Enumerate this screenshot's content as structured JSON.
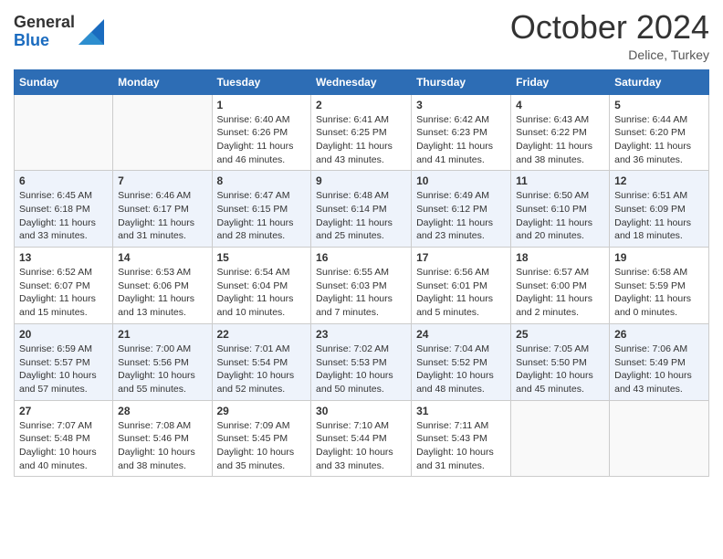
{
  "header": {
    "logo_general": "General",
    "logo_blue": "Blue",
    "month_title": "October 2024",
    "subtitle": "Delice, Turkey"
  },
  "days_of_week": [
    "Sunday",
    "Monday",
    "Tuesday",
    "Wednesday",
    "Thursday",
    "Friday",
    "Saturday"
  ],
  "weeks": [
    [
      {
        "day": "",
        "sunrise": "",
        "sunset": "",
        "daylight": ""
      },
      {
        "day": "",
        "sunrise": "",
        "sunset": "",
        "daylight": ""
      },
      {
        "day": "1",
        "sunrise": "Sunrise: 6:40 AM",
        "sunset": "Sunset: 6:26 PM",
        "daylight": "Daylight: 11 hours and 46 minutes."
      },
      {
        "day": "2",
        "sunrise": "Sunrise: 6:41 AM",
        "sunset": "Sunset: 6:25 PM",
        "daylight": "Daylight: 11 hours and 43 minutes."
      },
      {
        "day": "3",
        "sunrise": "Sunrise: 6:42 AM",
        "sunset": "Sunset: 6:23 PM",
        "daylight": "Daylight: 11 hours and 41 minutes."
      },
      {
        "day": "4",
        "sunrise": "Sunrise: 6:43 AM",
        "sunset": "Sunset: 6:22 PM",
        "daylight": "Daylight: 11 hours and 38 minutes."
      },
      {
        "day": "5",
        "sunrise": "Sunrise: 6:44 AM",
        "sunset": "Sunset: 6:20 PM",
        "daylight": "Daylight: 11 hours and 36 minutes."
      }
    ],
    [
      {
        "day": "6",
        "sunrise": "Sunrise: 6:45 AM",
        "sunset": "Sunset: 6:18 PM",
        "daylight": "Daylight: 11 hours and 33 minutes."
      },
      {
        "day": "7",
        "sunrise": "Sunrise: 6:46 AM",
        "sunset": "Sunset: 6:17 PM",
        "daylight": "Daylight: 11 hours and 31 minutes."
      },
      {
        "day": "8",
        "sunrise": "Sunrise: 6:47 AM",
        "sunset": "Sunset: 6:15 PM",
        "daylight": "Daylight: 11 hours and 28 minutes."
      },
      {
        "day": "9",
        "sunrise": "Sunrise: 6:48 AM",
        "sunset": "Sunset: 6:14 PM",
        "daylight": "Daylight: 11 hours and 25 minutes."
      },
      {
        "day": "10",
        "sunrise": "Sunrise: 6:49 AM",
        "sunset": "Sunset: 6:12 PM",
        "daylight": "Daylight: 11 hours and 23 minutes."
      },
      {
        "day": "11",
        "sunrise": "Sunrise: 6:50 AM",
        "sunset": "Sunset: 6:10 PM",
        "daylight": "Daylight: 11 hours and 20 minutes."
      },
      {
        "day": "12",
        "sunrise": "Sunrise: 6:51 AM",
        "sunset": "Sunset: 6:09 PM",
        "daylight": "Daylight: 11 hours and 18 minutes."
      }
    ],
    [
      {
        "day": "13",
        "sunrise": "Sunrise: 6:52 AM",
        "sunset": "Sunset: 6:07 PM",
        "daylight": "Daylight: 11 hours and 15 minutes."
      },
      {
        "day": "14",
        "sunrise": "Sunrise: 6:53 AM",
        "sunset": "Sunset: 6:06 PM",
        "daylight": "Daylight: 11 hours and 13 minutes."
      },
      {
        "day": "15",
        "sunrise": "Sunrise: 6:54 AM",
        "sunset": "Sunset: 6:04 PM",
        "daylight": "Daylight: 11 hours and 10 minutes."
      },
      {
        "day": "16",
        "sunrise": "Sunrise: 6:55 AM",
        "sunset": "Sunset: 6:03 PM",
        "daylight": "Daylight: 11 hours and 7 minutes."
      },
      {
        "day": "17",
        "sunrise": "Sunrise: 6:56 AM",
        "sunset": "Sunset: 6:01 PM",
        "daylight": "Daylight: 11 hours and 5 minutes."
      },
      {
        "day": "18",
        "sunrise": "Sunrise: 6:57 AM",
        "sunset": "Sunset: 6:00 PM",
        "daylight": "Daylight: 11 hours and 2 minutes."
      },
      {
        "day": "19",
        "sunrise": "Sunrise: 6:58 AM",
        "sunset": "Sunset: 5:59 PM",
        "daylight": "Daylight: 11 hours and 0 minutes."
      }
    ],
    [
      {
        "day": "20",
        "sunrise": "Sunrise: 6:59 AM",
        "sunset": "Sunset: 5:57 PM",
        "daylight": "Daylight: 10 hours and 57 minutes."
      },
      {
        "day": "21",
        "sunrise": "Sunrise: 7:00 AM",
        "sunset": "Sunset: 5:56 PM",
        "daylight": "Daylight: 10 hours and 55 minutes."
      },
      {
        "day": "22",
        "sunrise": "Sunrise: 7:01 AM",
        "sunset": "Sunset: 5:54 PM",
        "daylight": "Daylight: 10 hours and 52 minutes."
      },
      {
        "day": "23",
        "sunrise": "Sunrise: 7:02 AM",
        "sunset": "Sunset: 5:53 PM",
        "daylight": "Daylight: 10 hours and 50 minutes."
      },
      {
        "day": "24",
        "sunrise": "Sunrise: 7:04 AM",
        "sunset": "Sunset: 5:52 PM",
        "daylight": "Daylight: 10 hours and 48 minutes."
      },
      {
        "day": "25",
        "sunrise": "Sunrise: 7:05 AM",
        "sunset": "Sunset: 5:50 PM",
        "daylight": "Daylight: 10 hours and 45 minutes."
      },
      {
        "day": "26",
        "sunrise": "Sunrise: 7:06 AM",
        "sunset": "Sunset: 5:49 PM",
        "daylight": "Daylight: 10 hours and 43 minutes."
      }
    ],
    [
      {
        "day": "27",
        "sunrise": "Sunrise: 7:07 AM",
        "sunset": "Sunset: 5:48 PM",
        "daylight": "Daylight: 10 hours and 40 minutes."
      },
      {
        "day": "28",
        "sunrise": "Sunrise: 7:08 AM",
        "sunset": "Sunset: 5:46 PM",
        "daylight": "Daylight: 10 hours and 38 minutes."
      },
      {
        "day": "29",
        "sunrise": "Sunrise: 7:09 AM",
        "sunset": "Sunset: 5:45 PM",
        "daylight": "Daylight: 10 hours and 35 minutes."
      },
      {
        "day": "30",
        "sunrise": "Sunrise: 7:10 AM",
        "sunset": "Sunset: 5:44 PM",
        "daylight": "Daylight: 10 hours and 33 minutes."
      },
      {
        "day": "31",
        "sunrise": "Sunrise: 7:11 AM",
        "sunset": "Sunset: 5:43 PM",
        "daylight": "Daylight: 10 hours and 31 minutes."
      },
      {
        "day": "",
        "sunrise": "",
        "sunset": "",
        "daylight": ""
      },
      {
        "day": "",
        "sunrise": "",
        "sunset": "",
        "daylight": ""
      }
    ]
  ]
}
